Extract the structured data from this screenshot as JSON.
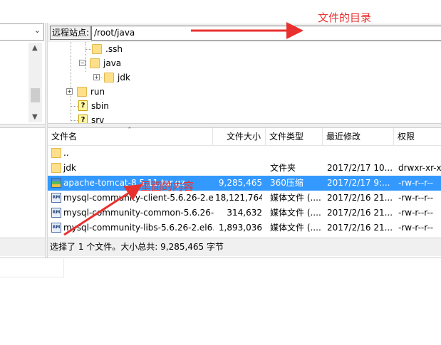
{
  "remote": {
    "site_label": "远程站点:",
    "path": "/root/java"
  },
  "tree": [
    {
      "name": ".ssh",
      "icon": "folder-icon"
    },
    {
      "name": "java",
      "icon": "folder-icon",
      "expanded": true
    },
    {
      "name": "jdk",
      "icon": "folder-icon",
      "collapsed": true
    },
    {
      "name": "run",
      "icon": "folder-icon",
      "collapsed": true
    },
    {
      "name": "sbin",
      "icon": "unknown-folder-icon"
    },
    {
      "name": "srv",
      "icon": "unknown-folder-icon"
    }
  ],
  "columns": {
    "name": "文件名",
    "size": "文件大小",
    "type": "文件类型",
    "modified": "最近修改",
    "perms": "权限"
  },
  "files": [
    {
      "name": "..",
      "size": "",
      "type": "",
      "modified": "",
      "perms": "",
      "icon": "folder-icon"
    },
    {
      "name": "jdk",
      "size": "",
      "type": "文件夹",
      "modified": "2017/2/17 10...",
      "perms": "drwxr-xr-x",
      "icon": "folder-icon"
    },
    {
      "name": "apache-tomcat-8.5.11.tar.gz",
      "size": "9,285,465",
      "type": "360压缩",
      "modified": "2017/2/17 9:...",
      "perms": "-rw-r--r--",
      "icon": "archive-icon",
      "selected": true
    },
    {
      "name": "mysql-community-client-5.6.26-2.e...",
      "size": "18,121,764",
      "type": "媒体文件 (....",
      "modified": "2017/2/16 21...",
      "perms": "-rw-r--r--",
      "icon": "rpm-icon"
    },
    {
      "name": "mysql-community-common-5.6.26-...",
      "size": "314,632",
      "type": "媒体文件 (....",
      "modified": "2017/2/16 21...",
      "perms": "-rw-r--r--",
      "icon": "rpm-icon"
    },
    {
      "name": "mysql-community-libs-5.6.26-2.el6...",
      "size": "1,893,036",
      "type": "媒体文件 (....",
      "modified": "2017/2/16 21...",
      "perms": "-rw-r--r--",
      "icon": "rpm-icon"
    }
  ],
  "status": "选择了 1 个文件。大小总共: 9,285,465 字节",
  "annotations": {
    "dir_note": "文件的目录",
    "content_note": "里面的内容"
  },
  "colors": {
    "selection": "#3399ff",
    "annotation": "#e8312f",
    "panel": "#f0f0f0"
  }
}
